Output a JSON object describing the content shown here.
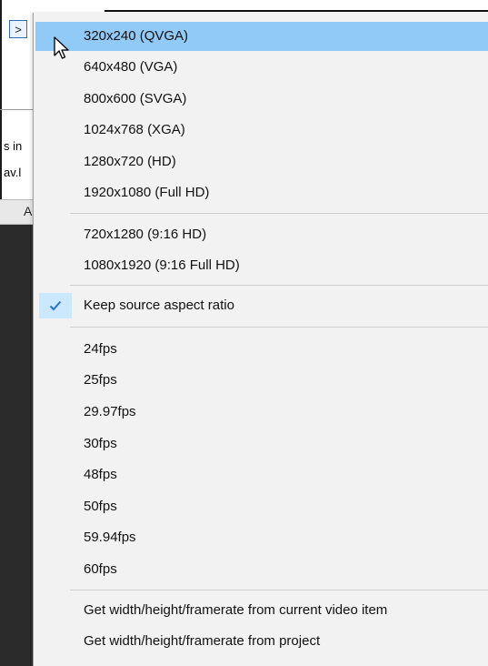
{
  "background": {
    "expand_button_label": ">",
    "text_line_1": "s in",
    "text_line_2": "av.l",
    "tab_label": "A"
  },
  "menu": {
    "resolutions": [
      {
        "label": "320x240 (QVGA)",
        "highlighted": true
      },
      {
        "label": "640x480 (VGA)"
      },
      {
        "label": "800x600 (SVGA)"
      },
      {
        "label": "1024x768 (XGA)"
      },
      {
        "label": "1280x720 (HD)"
      },
      {
        "label": "1920x1080 (Full HD)"
      }
    ],
    "vertical_resolutions": [
      {
        "label": "720x1280 (9:16 HD)"
      },
      {
        "label": "1080x1920 (9:16 Full HD)"
      }
    ],
    "aspect_option": {
      "label": "Keep source aspect ratio",
      "checked": true
    },
    "framerates": [
      {
        "label": "24fps"
      },
      {
        "label": "25fps"
      },
      {
        "label": "29.97fps"
      },
      {
        "label": "30fps"
      },
      {
        "label": "48fps"
      },
      {
        "label": "50fps"
      },
      {
        "label": "59.94fps"
      },
      {
        "label": "60fps"
      }
    ],
    "actions": [
      {
        "label": "Get width/height/framerate from current video item"
      },
      {
        "label": "Get width/height/framerate from project"
      }
    ]
  },
  "colors": {
    "highlight": "#91c9f7",
    "check_background": "#cce8ff",
    "check_mark": "#2a6fd1"
  },
  "icons": {
    "check": "check-icon",
    "cursor": "mouse-pointer-icon",
    "expand": "chevron-right-icon"
  }
}
